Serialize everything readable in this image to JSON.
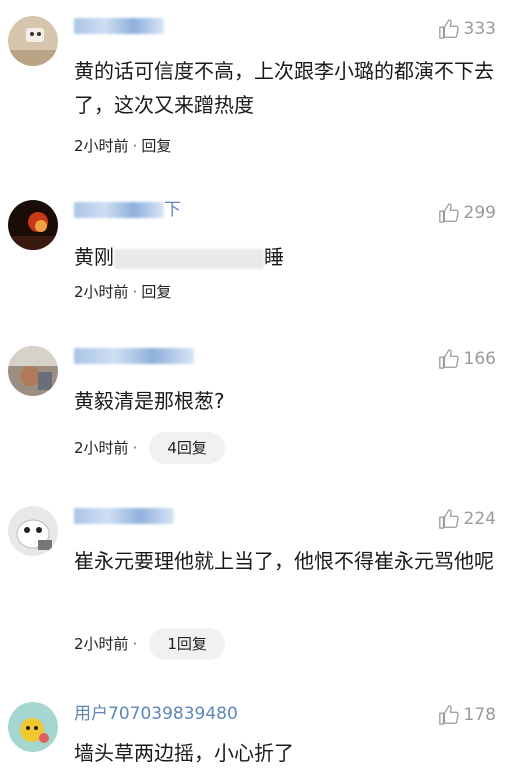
{
  "comments": [
    {
      "username": "",
      "likes": "333",
      "text": "黄的话可信度不高，上次跟李小璐的都演不下去了，这次又来蹭热度",
      "time": "2小时前",
      "reply_label": "回复",
      "reply_count_label": ""
    },
    {
      "username": "下",
      "likes": "299",
      "text": "黄刚",
      "text_tail": "睡",
      "time": "2小时前",
      "reply_label": "回复",
      "reply_count_label": ""
    },
    {
      "username": "",
      "likes": "166",
      "text": "黄毅清是那根葱?",
      "time": "2小时前",
      "reply_label": "",
      "reply_count_label": "4回复"
    },
    {
      "username": "",
      "likes": "224",
      "text": "崔永元要理他就上当了，他恨不得崔永元骂他呢",
      "time": "2小时前",
      "reply_label": "",
      "reply_count_label": "1回复"
    },
    {
      "username": "用户707039839480",
      "likes": "178",
      "text": "墙头草两边摇，小心折了",
      "time": "",
      "reply_label": "",
      "reply_count_label": ""
    }
  ],
  "colors": {
    "username": "#5f86b8",
    "like_gray": "#9a9a9a",
    "pill_bg": "#f1f1f1"
  },
  "icons": [
    "thumbs-up-icon",
    "avatar"
  ]
}
